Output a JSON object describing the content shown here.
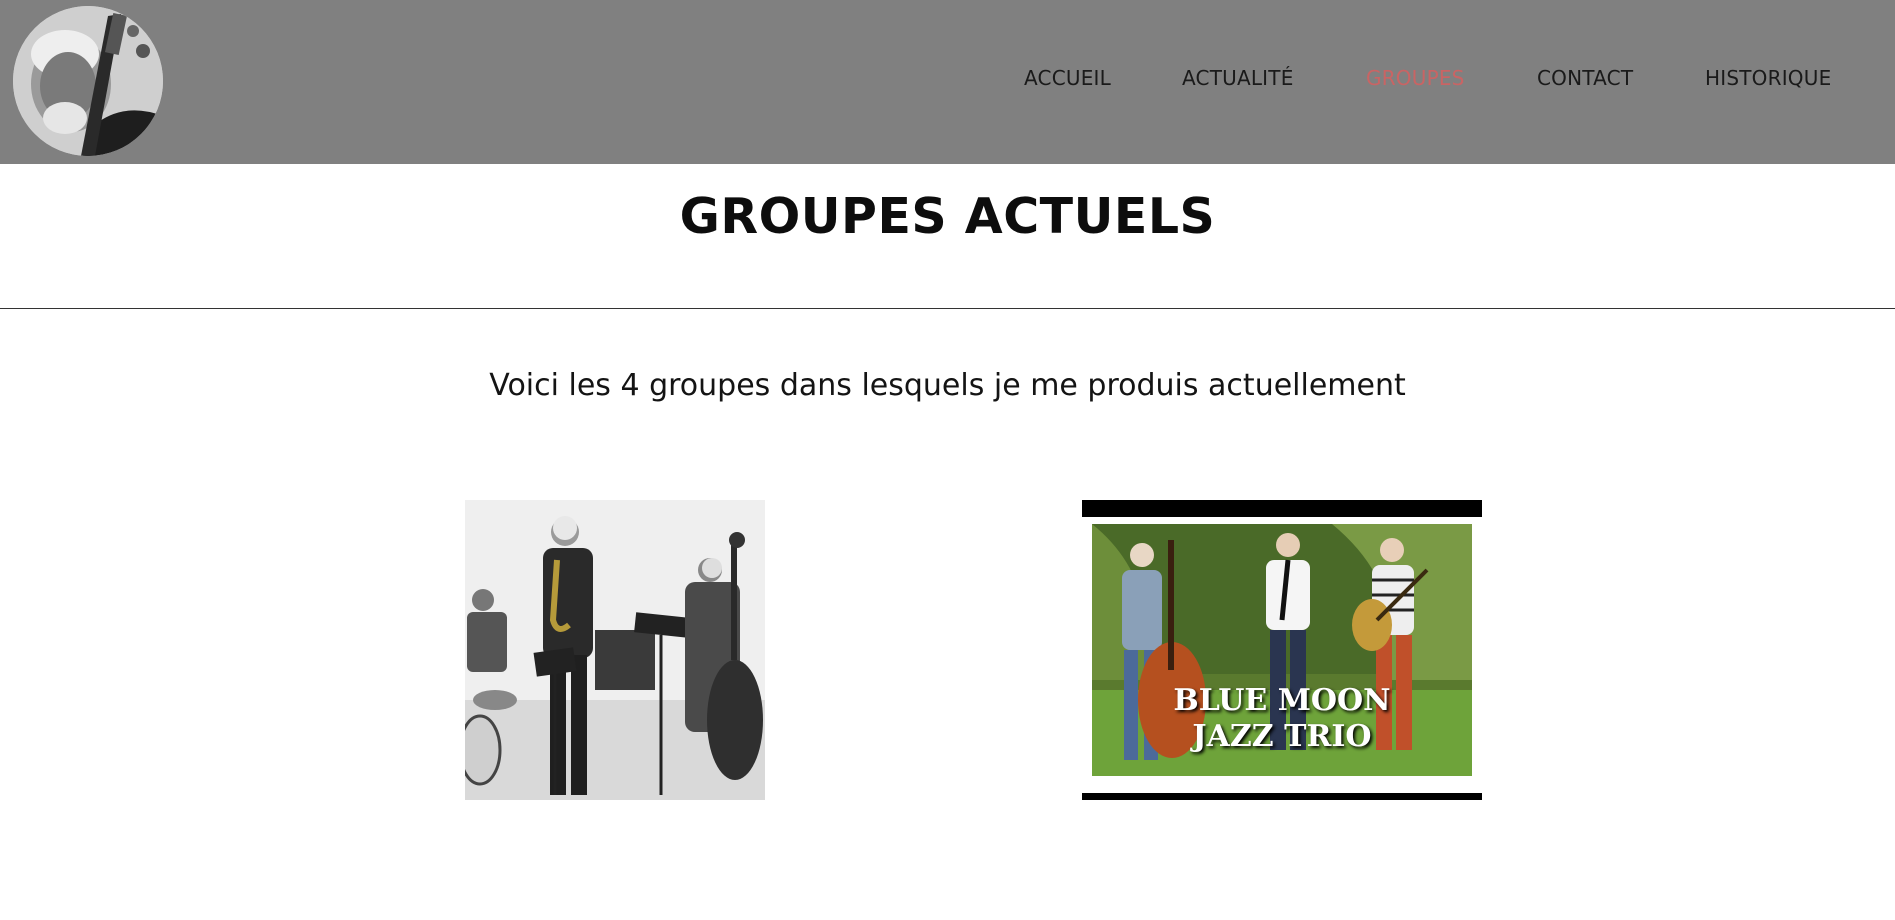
{
  "nav": {
    "items": [
      {
        "label": "ACCUEIL",
        "active": false
      },
      {
        "label": "ACTUALITÉ",
        "active": false
      },
      {
        "label": "GROUPES",
        "active": true
      },
      {
        "label": "CONTACT",
        "active": false
      },
      {
        "label": "HISTORIQUE",
        "active": false
      }
    ],
    "active_color": "#c96464",
    "bar_color": "#808080"
  },
  "page": {
    "title": "GROUPES ACTUELS",
    "intro": "Voici les 4 groupes dans lesquels je me produis actuellement"
  },
  "groups": [
    {
      "image_alt": "band-photo-bw"
    },
    {
      "image_text_line1": "BLUE MOON",
      "image_text_line2": "JAZZ TRIO"
    }
  ]
}
